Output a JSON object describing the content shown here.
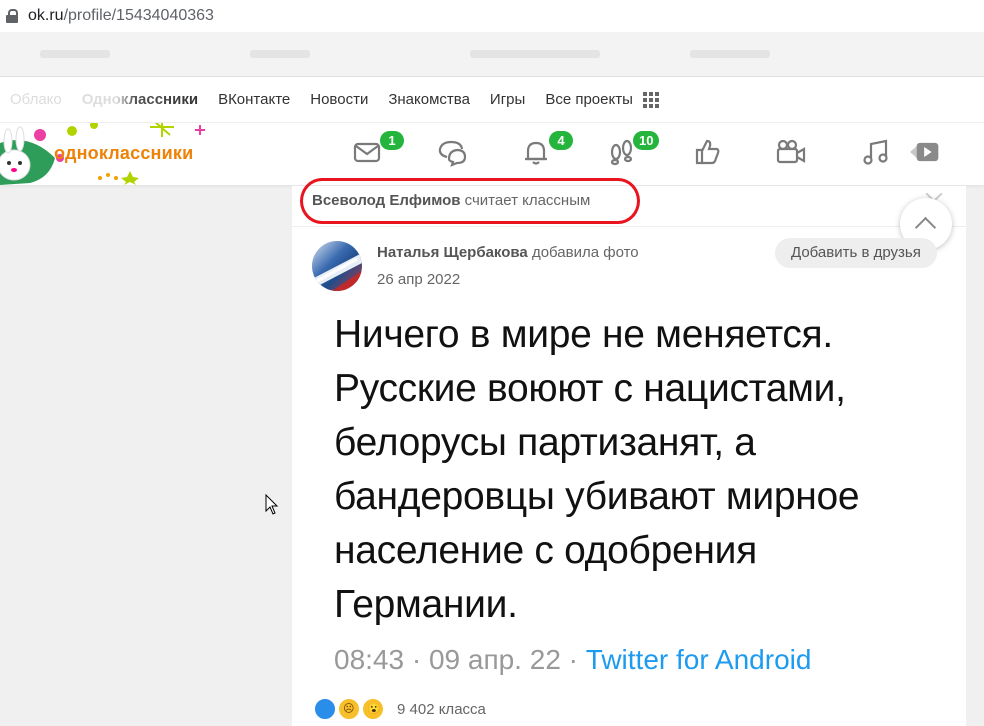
{
  "browser": {
    "url_host": "ok.ru",
    "url_path": "/profile/15434040363"
  },
  "topnav": {
    "items": [
      {
        "label": "Облако",
        "state": "faded"
      },
      {
        "label": "Одноклассники",
        "state": "half"
      },
      {
        "label": "ВКонтакте",
        "state": "normal"
      },
      {
        "label": "Новости",
        "state": "normal"
      },
      {
        "label": "Знакомства",
        "state": "normal"
      },
      {
        "label": "Игры",
        "state": "normal"
      },
      {
        "label": "Все проекты",
        "state": "normal"
      }
    ]
  },
  "header": {
    "logo_text": "одноклассники",
    "icons": [
      {
        "name": "messages-icon",
        "badge": "1"
      },
      {
        "name": "discussions-icon",
        "badge": ""
      },
      {
        "name": "notifications-icon",
        "badge": "4"
      },
      {
        "name": "guests-icon",
        "badge": "10"
      },
      {
        "name": "events-icon",
        "badge": ""
      },
      {
        "name": "video-icon",
        "badge": ""
      },
      {
        "name": "music-icon",
        "badge": ""
      },
      {
        "name": "video-play-icon",
        "badge": ""
      }
    ],
    "colors": {
      "brand": "#ee8208",
      "badge": "#25b43c"
    }
  },
  "feed": {
    "liker_name": "Всеволод Елфимов",
    "liker_action": "считает классным",
    "author_name": "Наталья Щербакова",
    "author_action": "добавила фото",
    "date": "26 апр 2022",
    "add_friend_label": "Добавить в друзья",
    "post_lines": [
      "Ничего в мире не меняется.",
      "Русские воюют с нацистами,",
      "белорусы партизанят, а",
      "бандеровцы убивают мирное",
      "население с одобрения",
      "Германии."
    ],
    "tweet_time": "08:43 · 09 апр. 22 · ",
    "tweet_source": "Twitter for Android",
    "klass_count": "9 402 класса",
    "highlight_color": "#e8151f"
  }
}
